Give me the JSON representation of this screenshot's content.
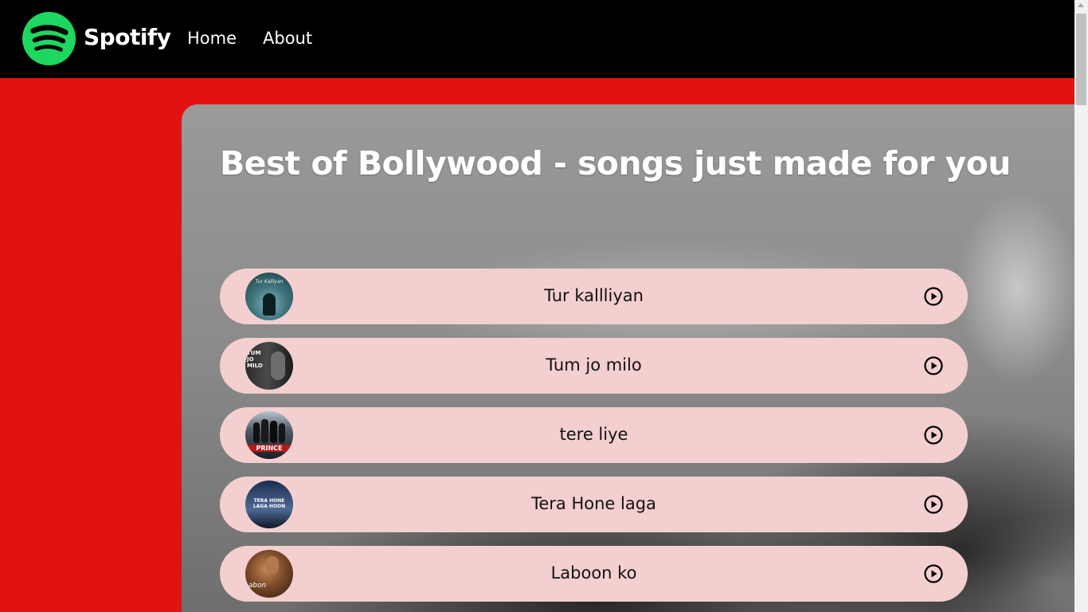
{
  "navbar": {
    "brand": "Spotify",
    "links": [
      {
        "label": "Home"
      },
      {
        "label": "About"
      }
    ]
  },
  "main": {
    "title": "Best of Bollywood - songs just made for you"
  },
  "songs": [
    {
      "title": "Tur kallliyan",
      "cover_text": "Tur Kalliyan"
    },
    {
      "title": "Tum jo milo",
      "cover_text": "TUM JO MILO"
    },
    {
      "title": "tere liye",
      "cover_text": "PRINCE"
    },
    {
      "title": "Tera Hone laga",
      "cover_text": "TERA HONE LAGA HOON"
    },
    {
      "title": "Laboon ko",
      "cover_text": "abon"
    }
  ],
  "colors": {
    "page_background": "#e21212",
    "navbar_background": "#000000",
    "brand_green": "#1ed760",
    "song_card": "#f4cfcf"
  },
  "icons": {
    "logo": "spotify-logo-icon",
    "play": "play-circle-icon"
  }
}
